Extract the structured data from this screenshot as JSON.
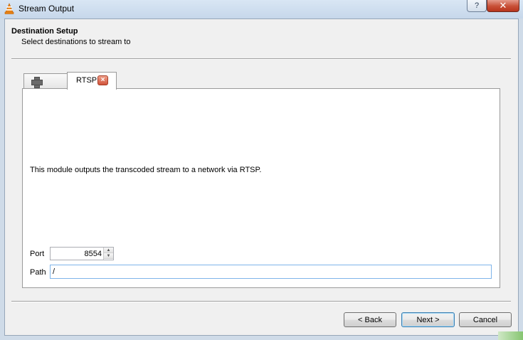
{
  "window": {
    "title": "Stream Output",
    "help_label": "?",
    "close_label": "✕"
  },
  "header": {
    "title": "Destination Setup",
    "subtitle": "Select destinations to stream to"
  },
  "tabs": [
    {
      "label": "",
      "icon": "plus-icon"
    },
    {
      "label": "RTSP",
      "close_label": "×",
      "selected": true
    }
  ],
  "module": {
    "description": "This module outputs the transcoded stream to a network via RTSP.",
    "port_label": "Port",
    "port_value": "8554",
    "path_label": "Path",
    "path_value": "/"
  },
  "buttons": {
    "back": "< Back",
    "next": "Next >",
    "cancel": "Cancel"
  },
  "colors": {
    "accent_close": "#c74f36",
    "default_button_border": "#3c7fb1",
    "focus_border": "#7eb4ea"
  }
}
